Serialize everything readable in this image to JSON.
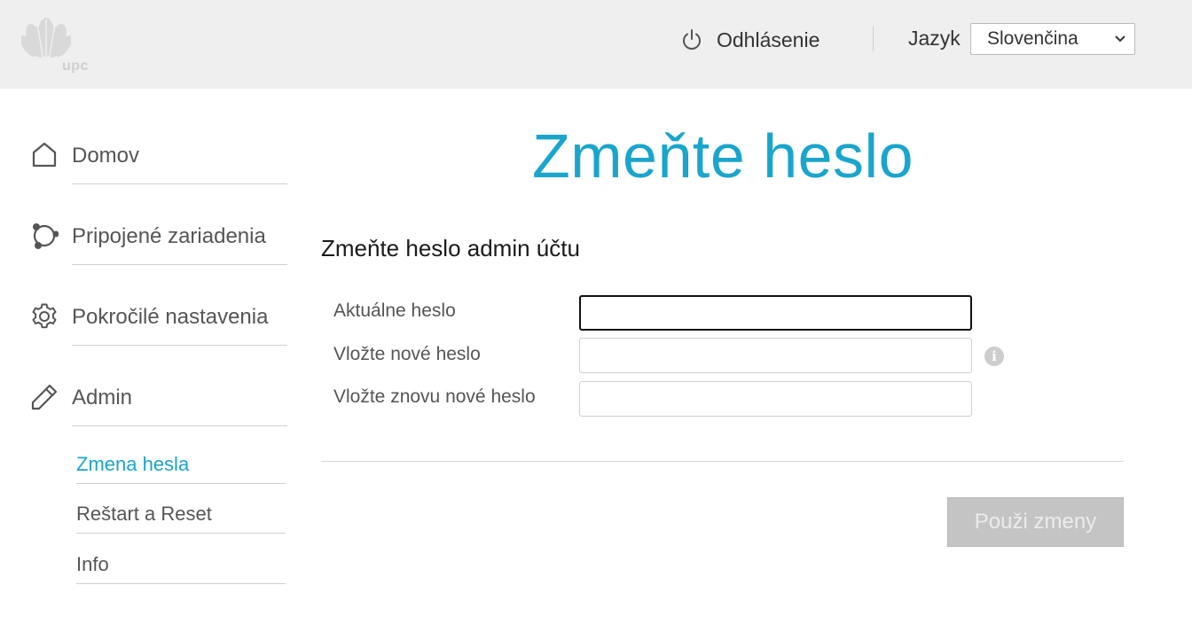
{
  "header": {
    "logo_text": "upc",
    "logout_label": "Odhlásenie",
    "language_label": "Jazyk",
    "language_selected": "Slovenčina"
  },
  "sidebar": {
    "items": [
      {
        "label": "Domov",
        "icon": "home-icon"
      },
      {
        "label": "Pripojené zariadenia",
        "icon": "connected-devices-icon"
      },
      {
        "label": "Pokročilé nastavenia",
        "icon": "gear-icon"
      },
      {
        "label": "Admin",
        "icon": "pencil-icon"
      }
    ],
    "subitems": [
      {
        "label": "Zmena hesla",
        "active": true
      },
      {
        "label": "Reštart a Reset",
        "active": false
      },
      {
        "label": "Info",
        "active": false
      }
    ]
  },
  "main": {
    "title": "Zmeňte heslo",
    "section_heading": "Zmeňte heslo admin účtu",
    "fields": [
      {
        "label": "Aktuálne heslo",
        "value": ""
      },
      {
        "label": "Vložte nové heslo",
        "value": ""
      },
      {
        "label": "Vložte znovu nové heslo",
        "value": ""
      }
    ],
    "info_glyph": "i",
    "apply_label": "Použi zmeny"
  },
  "colors": {
    "accent": "#1aa5cc",
    "header_bg": "#efefef",
    "disabled_button": "#c4c4c4"
  }
}
